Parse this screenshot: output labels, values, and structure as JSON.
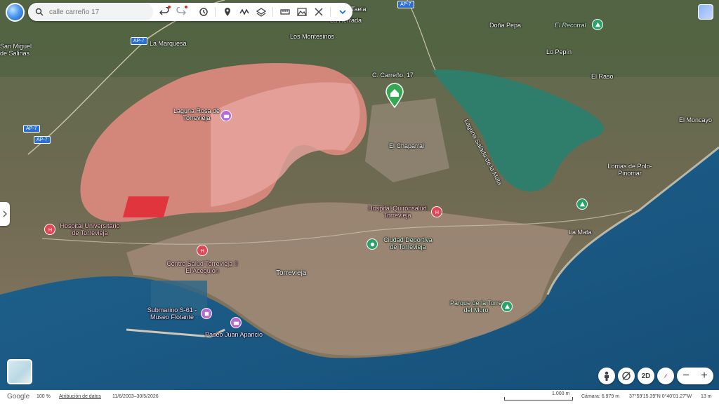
{
  "search": {
    "placeholder": "calle carreño 17"
  },
  "toolbar": {
    "undo": "undo-icon",
    "redo": "redo-icon",
    "history": "history-icon",
    "place": "place-pin-icon",
    "path": "path-icon",
    "layers": "layers-icon",
    "measure": "ruler-icon",
    "photo": "photo-icon",
    "crop": "crop-icon",
    "more": "chevron-down-icon"
  },
  "places": [
    "Taela",
    "La Herrada",
    "Doña Pepa",
    "El Recorral",
    "Los Montesinos",
    "La Marquesa",
    "San Miguel de Salinas",
    "Lo Pepín",
    "El Raso",
    "C. Carreño, 17",
    "Laguna Rosa de Torrevieja",
    "Laguna Salada de la Mata",
    "El Moncayo",
    "El Chaparral",
    "Lomas de Polo-Pinomar",
    "Hospital Universitario de Torrevieja",
    "Hospital Quirónsalud Torrevieja",
    "Ciudad Deportiva de Torrevieja",
    "La Mata",
    "Centro Salud Torrevieja II El Acequión",
    "Torrevieja",
    "Parque de la Torre del Moro",
    "Submarino S-61 - Museo Flotante",
    "Paseo Juan Aparicio"
  ],
  "roads": [
    "AP-7",
    "AP-7",
    "AP-7",
    "AP-7"
  ],
  "controls": {
    "view_2d": "2D",
    "zoom_out": "−",
    "zoom_in": "+"
  },
  "status": {
    "logo": "Google",
    "zoom": "100 %",
    "attribution": "Atribución de datos",
    "dates": "11/6/2003–30/5/2026",
    "scale": "1.000 m",
    "camera": "Cámara: 6.979 m",
    "coords": "37°59'15.39\"N 0°40'01.27\"W",
    "elevation": "13 m"
  },
  "colors": {
    "pink_lagoon": "#d98a7e",
    "green_lagoon": "#2f7f6e",
    "sea": "#1f5f8a",
    "pin_home": "#34a853"
  }
}
